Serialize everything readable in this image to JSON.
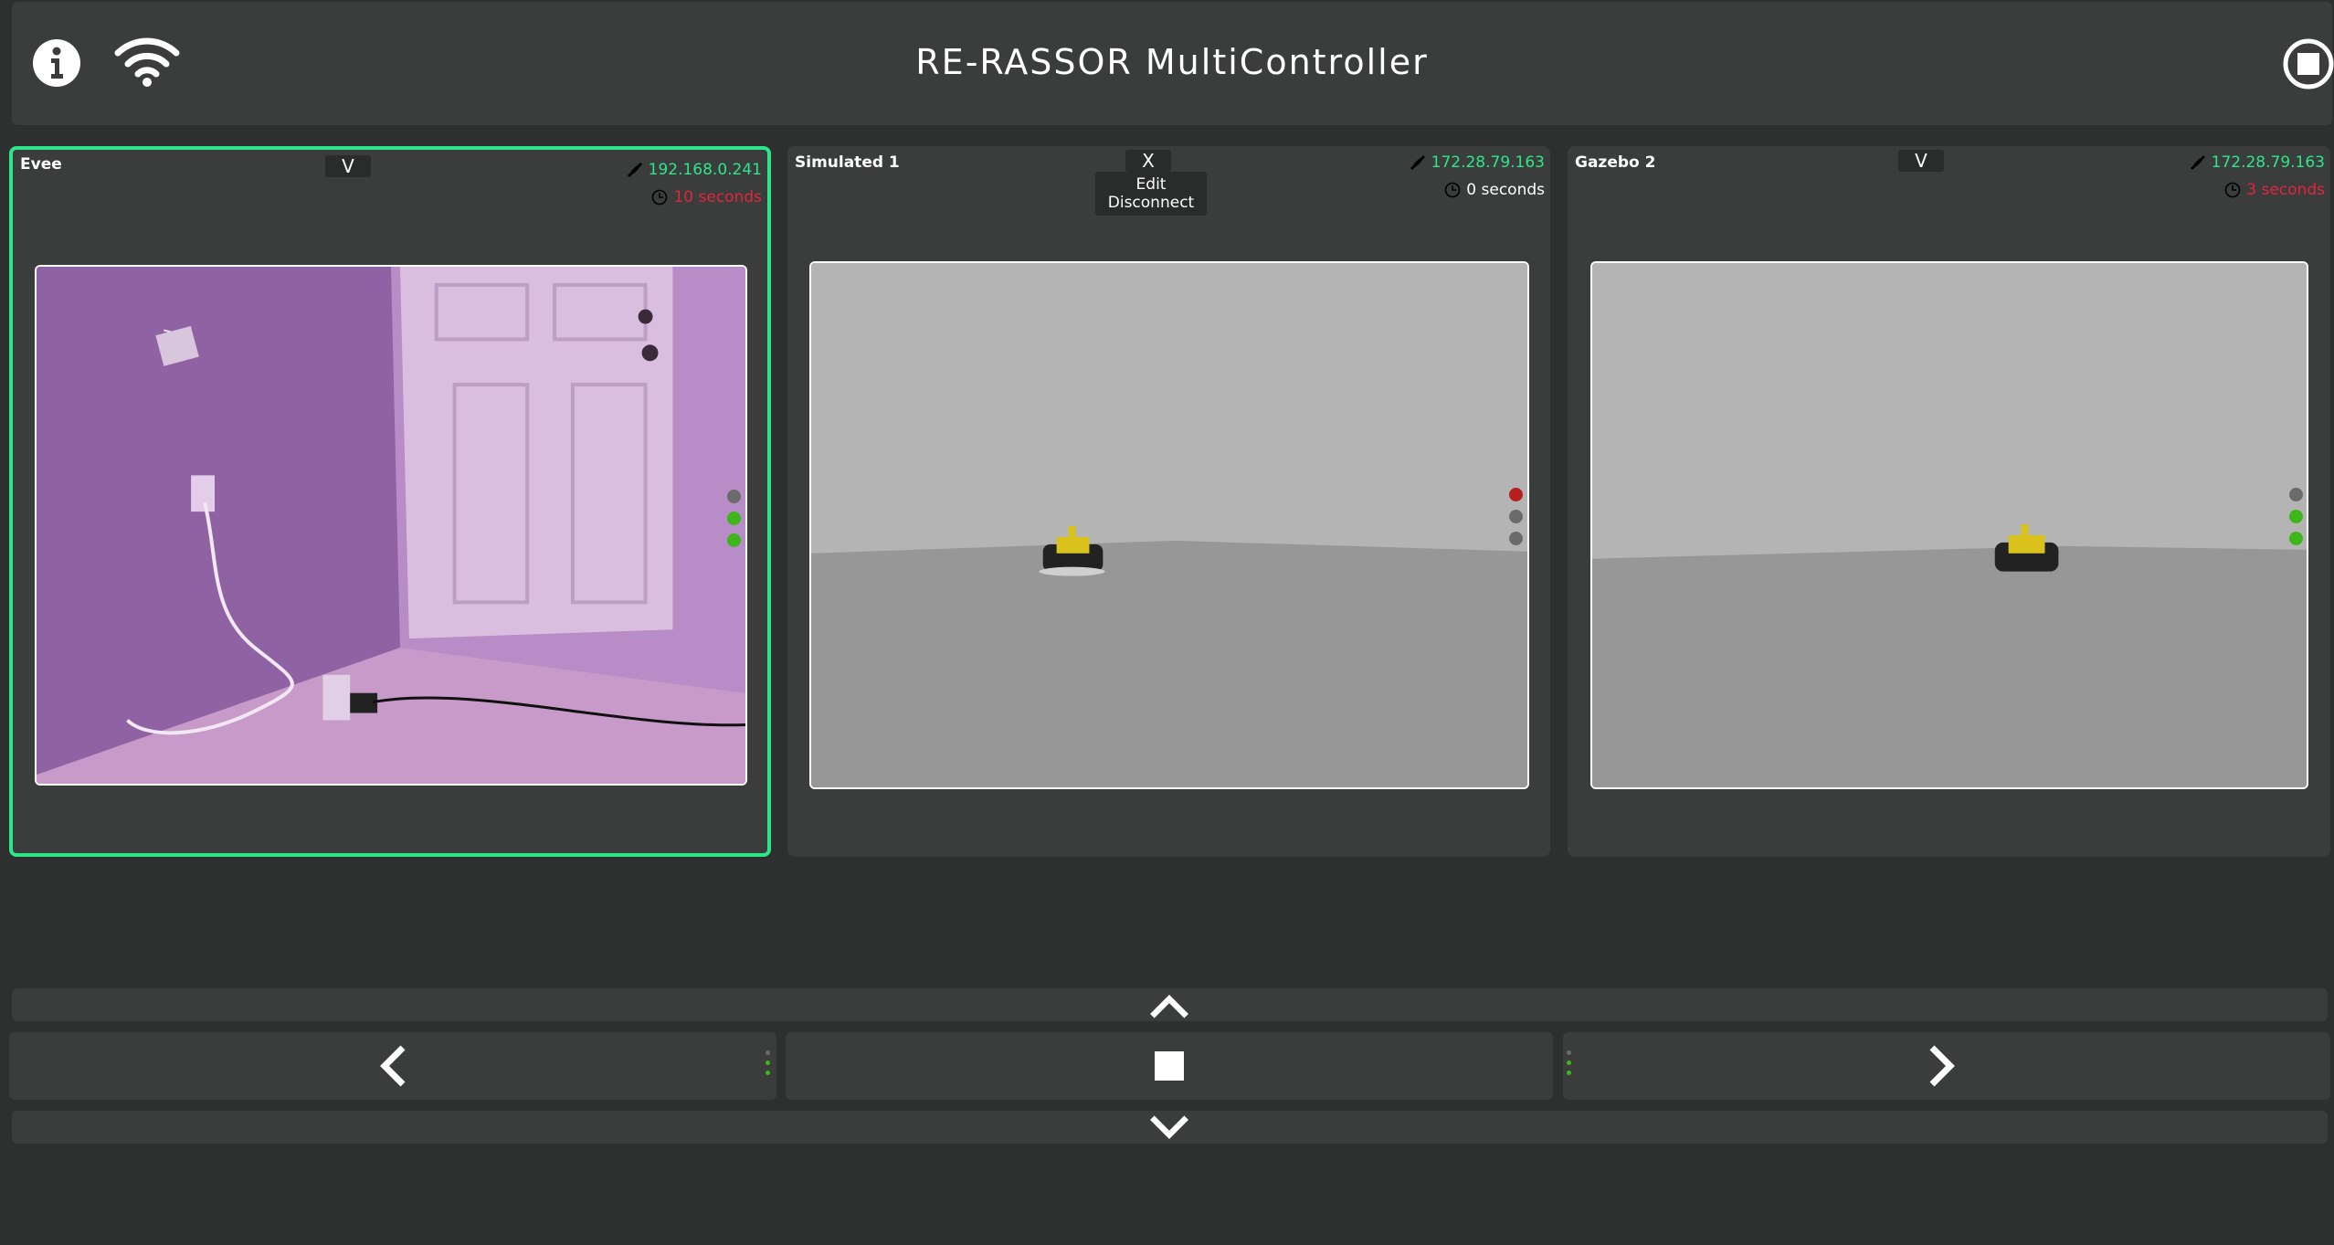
{
  "header": {
    "title": "RE-RASSOR MultiController",
    "icons": [
      "info-icon",
      "wifi-icon",
      "stop-icon"
    ]
  },
  "rovers": [
    {
      "name": "Evee",
      "toggle_label": "V",
      "ip": "192.168.0.241",
      "latency": "10 seconds",
      "latency_status": "bad",
      "selected": true,
      "left_leds": [
        "#6b6b6b",
        "#3fb51c",
        "#3fb51c"
      ],
      "right_leds": [
        "#6b6b6b",
        "#3fb51c",
        "#3fb51c"
      ]
    },
    {
      "name": "Simulated 1",
      "toggle_label": "X",
      "menu": [
        "Edit",
        "Disconnect"
      ],
      "ip": "172.28.79.163",
      "latency": "0 seconds",
      "latency_status": "ok",
      "selected": false,
      "left_leds": [
        "#b5201f",
        "#6b6b6b",
        "#6b6b6b"
      ],
      "right_leds": [
        "#b5201f",
        "#6b6b6b",
        "#6b6b6b"
      ]
    },
    {
      "name": "Gazebo 2",
      "toggle_label": "V",
      "ip": "172.28.79.163",
      "latency": "3 seconds",
      "latency_status": "bad",
      "selected": false,
      "left_leds": [
        "#b5201f",
        "#b5201f",
        "#6b6b6b"
      ],
      "right_leds": [
        "#6b6b6b",
        "#3fb51c",
        "#3fb51c"
      ]
    }
  ],
  "colors": {
    "accent": "#2ee68a",
    "error": "#e0263c",
    "led_green": "#3fb51c",
    "led_red": "#b5201f",
    "led_off": "#6b6b6b"
  },
  "controls": {
    "icons": [
      "chevron-up-icon",
      "chevron-left-icon",
      "stop-square-icon",
      "chevron-right-icon",
      "chevron-down-icon"
    ]
  }
}
